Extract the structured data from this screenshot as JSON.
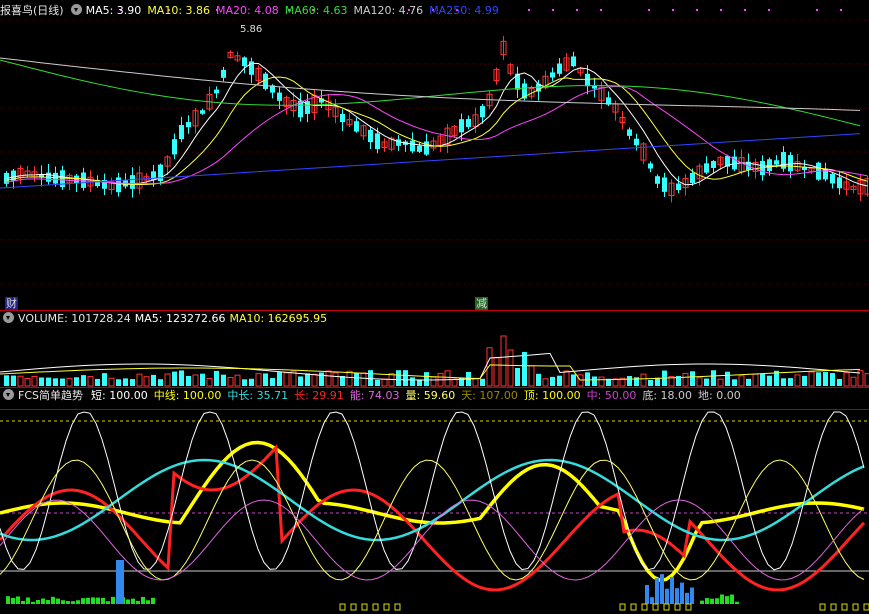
{
  "price": {
    "title": "报喜鸟(日线)",
    "labels": [
      {
        "text": "MA5: 3.90",
        "color": "#ffffff"
      },
      {
        "text": "MA10: 3.86",
        "color": "#ffff33"
      },
      {
        "text": "MA20: 4.08",
        "color": "#ff44ff"
      },
      {
        "text": "MA60: 4.63",
        "color": "#33dd33"
      },
      {
        "text": "MA120: 4.76",
        "color": "#cccccc"
      },
      {
        "text": "MA250: 4.99",
        "color": "#3344ff"
      }
    ],
    "high_label": "5.86",
    "tag_left": "财",
    "tag_right": "减"
  },
  "volume": {
    "title": "VOLUME: 101728.24",
    "ma5": "MA5: 123272.66",
    "ma10": "MA10: 162695.95"
  },
  "fcs": {
    "title": "FCS简单趋势",
    "labels": [
      {
        "text": "短: 100.00",
        "color": "#ffffff"
      },
      {
        "text": "中线: 100.00",
        "color": "#ffff00"
      },
      {
        "text": "中长: 35.71",
        "color": "#33dddd"
      },
      {
        "text": "长: 29.91",
        "color": "#ff2222"
      },
      {
        "text": "能: 74.03",
        "color": "#dd66dd"
      },
      {
        "text": "量: 59.60",
        "color": "#ffff66"
      },
      {
        "text": "天: 107.00",
        "color": "#998800"
      },
      {
        "text": "顶: 100.00",
        "color": "#ffff00"
      },
      {
        "text": "中: 50.00",
        "color": "#cc44cc"
      },
      {
        "text": "底: 18.00",
        "color": "#cccccc"
      },
      {
        "text": "地: 0.00",
        "color": "#cccccc"
      }
    ]
  },
  "colors": {
    "up": "#ff3333",
    "down": "#33ffff",
    "ma5": "#ffffff",
    "ma10": "#ffff33",
    "ma20": "#ff44ff",
    "ma60": "#33dd33",
    "ma120": "#cccccc",
    "ma250": "#3344ff",
    "divider": "#c00000"
  }
}
